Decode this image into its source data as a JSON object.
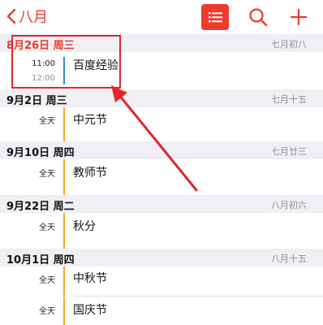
{
  "nav": {
    "back_label": "八月"
  },
  "colors": {
    "accent": "#e53b30",
    "event_blue": "#2f8fd8",
    "event_orange": "#f5a623"
  },
  "sections": [
    {
      "date": "8月26日 周三",
      "lunar": "七月初八",
      "events": [
        {
          "time_start": "11:00",
          "time_end": "12:00",
          "title": "百度经验",
          "status": "现在"
        }
      ]
    },
    {
      "date": "9月2日 周三",
      "lunar": "七月十五",
      "events": [
        {
          "time": "全天",
          "title": "中元节"
        }
      ]
    },
    {
      "date": "9月10日 周四",
      "lunar": "七月廿三",
      "events": [
        {
          "time": "全天",
          "title": "教师节"
        }
      ]
    },
    {
      "date": "9月22日 周二",
      "lunar": "八月初六",
      "events": [
        {
          "time": "全天",
          "title": "秋分"
        }
      ]
    },
    {
      "date": "10月1日 周四",
      "lunar": "八月十五",
      "events": [
        {
          "time": "全天",
          "title": "中秋节"
        },
        {
          "time": "全天",
          "title": "国庆节"
        }
      ]
    }
  ]
}
